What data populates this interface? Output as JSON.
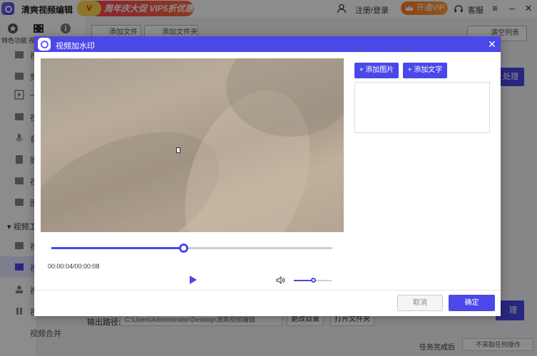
{
  "app": {
    "title": "清爽视频编辑",
    "promo_text": "周年庆大促 VIP5折优惠",
    "promo_badge": "V",
    "login_label": "注册/登录",
    "vip_label": "开通VIP",
    "support_label": "客服"
  },
  "topnav": {
    "items": [
      {
        "label": "特色功能",
        "icon": "star-icon"
      },
      {
        "label": "视",
        "icon": "film-icon"
      },
      {
        "label": "",
        "icon": "info-icon"
      }
    ]
  },
  "sidebar": {
    "items": [
      {
        "label": "视",
        "icon": "video-icon"
      },
      {
        "label": "剪",
        "icon": "scissors-icon"
      },
      {
        "label": "一",
        "icon": "play-icon"
      },
      {
        "label": "视",
        "icon": "clip-icon"
      },
      {
        "label": "音",
        "icon": "mic-icon"
      },
      {
        "label": "脚",
        "icon": "script-icon"
      },
      {
        "label": "视",
        "icon": "frame-icon"
      },
      {
        "label": "图",
        "icon": "image-icon"
      }
    ],
    "group_label": "视频工",
    "sub_items": [
      {
        "label": "视",
        "icon": "tool-icon"
      },
      {
        "label": "视",
        "icon": "watermark-icon"
      },
      {
        "label": "视",
        "icon": "stamp-icon"
      },
      {
        "label": "视",
        "icon": "pause-icon"
      },
      {
        "label": "视频合并",
        "icon": "merge-icon"
      }
    ]
  },
  "toolbar": {
    "add_file": "添加文件",
    "add_folder": "添加文件夹",
    "clear_list": "清空列表",
    "process_label": "处理",
    "process_label_bottom": "理"
  },
  "output": {
    "path_label": "输出路径:",
    "path_value": "C:\\Users\\Administrator\\Desktop\\清爽视频编辑",
    "change_dir": "更改目录",
    "open_folder": "打开文件夹"
  },
  "status": {
    "done_label": "任务完成后",
    "done_option": "不采取任何操作"
  },
  "dialog": {
    "title": "视频加水印",
    "add_image": "+ 添加图片",
    "add_text": "+ 添加文字",
    "timecode": "00:00:04/00:00:08",
    "progress_fraction": 0.47,
    "volume_fraction": 0.5,
    "cancel": "取消",
    "confirm": "确定"
  },
  "colors": {
    "accent": "#4a48e8",
    "promo": "#ff3b5c",
    "vip": "#ff8a2a"
  }
}
